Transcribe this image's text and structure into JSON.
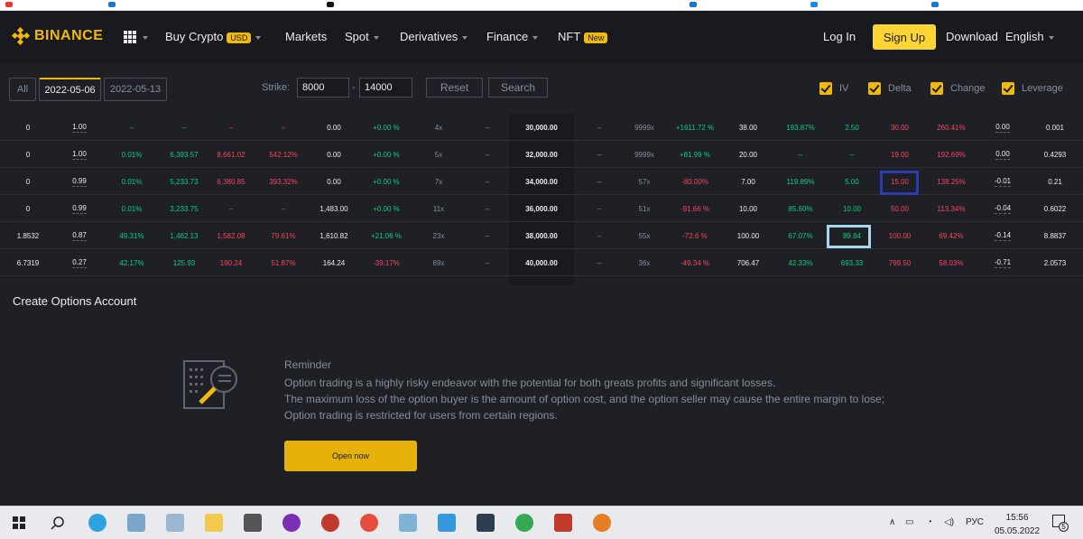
{
  "brand": {
    "name": "BINANCE",
    "color": "#f0b90b"
  },
  "nav": {
    "buy_crypto": "Buy Crypto",
    "currency_badge": "USD",
    "markets": "Markets",
    "spot": "Spot",
    "derivatives": "Derivatives",
    "finance": "Finance",
    "nft": "NFT",
    "nft_badge": "New",
    "login": "Log In",
    "signup": "Sign Up",
    "download": "Download",
    "language": "English"
  },
  "filters": {
    "all": "All",
    "date1": "2022-05-06",
    "date2": "2022-05-13",
    "strike_label": "Strike:",
    "strike_min": "8000",
    "strike_max": "14000",
    "dash": "-",
    "reset": "Reset",
    "search": "Search",
    "checks": [
      "IV",
      "Delta",
      "Change",
      "Leverage"
    ]
  },
  "rows": [
    [
      "0",
      "1.00",
      "--",
      "--",
      "--",
      "--",
      "0.00",
      "+0.00 %",
      "4x",
      "--",
      "30,000.00",
      "--",
      "9999x",
      "+1611.72 %",
      "38.00",
      "193.87%",
      "2.50",
      "30.00",
      "260.41%",
      "0.00",
      "0.001"
    ],
    [
      "0",
      "1.00",
      "0.01%",
      "6,393.57",
      "8,661.02",
      "542.12%",
      "0.00",
      "+0.00 %",
      "5x",
      "--",
      "32,000.00",
      "--",
      "9999x",
      "+81.99 %",
      "20.00",
      "--",
      "--",
      "19.00",
      "192.69%",
      "0.00",
      "0.4293"
    ],
    [
      "0",
      "0.99",
      "0.01%",
      "5,233.73",
      "6,380.85",
      "393.32%",
      "0.00",
      "+0.00 %",
      "7x",
      "--",
      "34,000.00",
      "--",
      "57x",
      "-80.00%",
      "7.00",
      "119.89%",
      "5.00",
      "15.00",
      "138.25%",
      "-0.01",
      "0.21"
    ],
    [
      "0",
      "0.99",
      "0.01%",
      "3,233.75",
      "--",
      "--",
      "1,483.00",
      "+0.00 %",
      "11x",
      "--",
      "36,000.00",
      "--",
      "51x",
      "-91.66 %",
      "10.00",
      "85.60%",
      "10.00",
      "50.00",
      "113.34%",
      "-0.04",
      "0.6022"
    ],
    [
      "1.8532",
      "0.87",
      "49.31%",
      "1,462.13",
      "1,582.08",
      "79.61%",
      "1,610.82",
      "+21.06 %",
      "23x",
      "--",
      "38,000.00",
      "--",
      "55x",
      "-72.6 %",
      "100.00",
      "67.07%",
      "89.84",
      "100.00",
      "69.42%",
      "-0.14",
      "8.8837"
    ],
    [
      "6.7319",
      "0.27",
      "42.17%",
      "125.93",
      "190.24",
      "51.87%",
      "164.24",
      "-39.17%",
      "69x",
      "--",
      "40,000.00",
      "--",
      "36x",
      "-49.34 %",
      "706.47",
      "42.33%",
      "693.33",
      "799.50",
      "58.03%",
      "-0.71",
      "2.0573"
    ]
  ],
  "create_account": "Create Options Account",
  "reminder": {
    "title": "Reminder",
    "line1": "Option trading is a highly risky endeavor with the potential for both greats profits and significant losses.",
    "line2": "The maximum loss of the option buyer is the amount of option cost, and the option seller may cause the entire margin to lose;",
    "line3": "Option trading is restricted for users from certain regions.",
    "button": "Open now"
  },
  "taskbar": {
    "lang": "РУС",
    "time": "15:56",
    "date": "05.05.2022",
    "notif_count": "5"
  },
  "colors": {
    "green": "#0ecb81",
    "red": "#f6465d",
    "yellow": "#fcd535",
    "bg": "#1e2026"
  }
}
